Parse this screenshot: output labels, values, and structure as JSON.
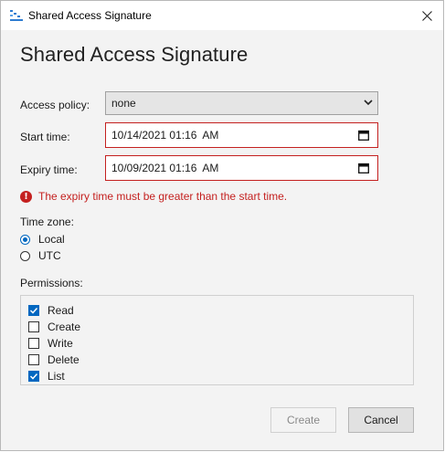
{
  "window": {
    "title": "Shared Access Signature",
    "close_glyph": "✕"
  },
  "form": {
    "heading": "Shared Access Signature",
    "access_policy": {
      "label": "Access policy:",
      "value": "none"
    },
    "start_time": {
      "label": "Start time:",
      "value": "10/14/2021 01:16  AM"
    },
    "expiry_time": {
      "label": "Expiry time:",
      "value": "10/09/2021 01:16  AM"
    },
    "error": {
      "icon": "error-icon",
      "glyph": "!",
      "message": "The expiry time must be greater than the start time."
    },
    "time_zone": {
      "label": "Time zone:",
      "options": [
        {
          "label": "Local",
          "checked": true
        },
        {
          "label": "UTC",
          "checked": false
        }
      ]
    },
    "permissions": {
      "label": "Permissions:",
      "items": [
        {
          "label": "Read",
          "checked": true
        },
        {
          "label": "Create",
          "checked": false
        },
        {
          "label": "Write",
          "checked": false
        },
        {
          "label": "Delete",
          "checked": false
        },
        {
          "label": "List",
          "checked": true
        }
      ]
    },
    "buttons": {
      "create": "Create",
      "cancel": "Cancel"
    }
  },
  "colors": {
    "error": "#c4201f",
    "accent": "#0067c0",
    "background": "#f3f3f3"
  }
}
